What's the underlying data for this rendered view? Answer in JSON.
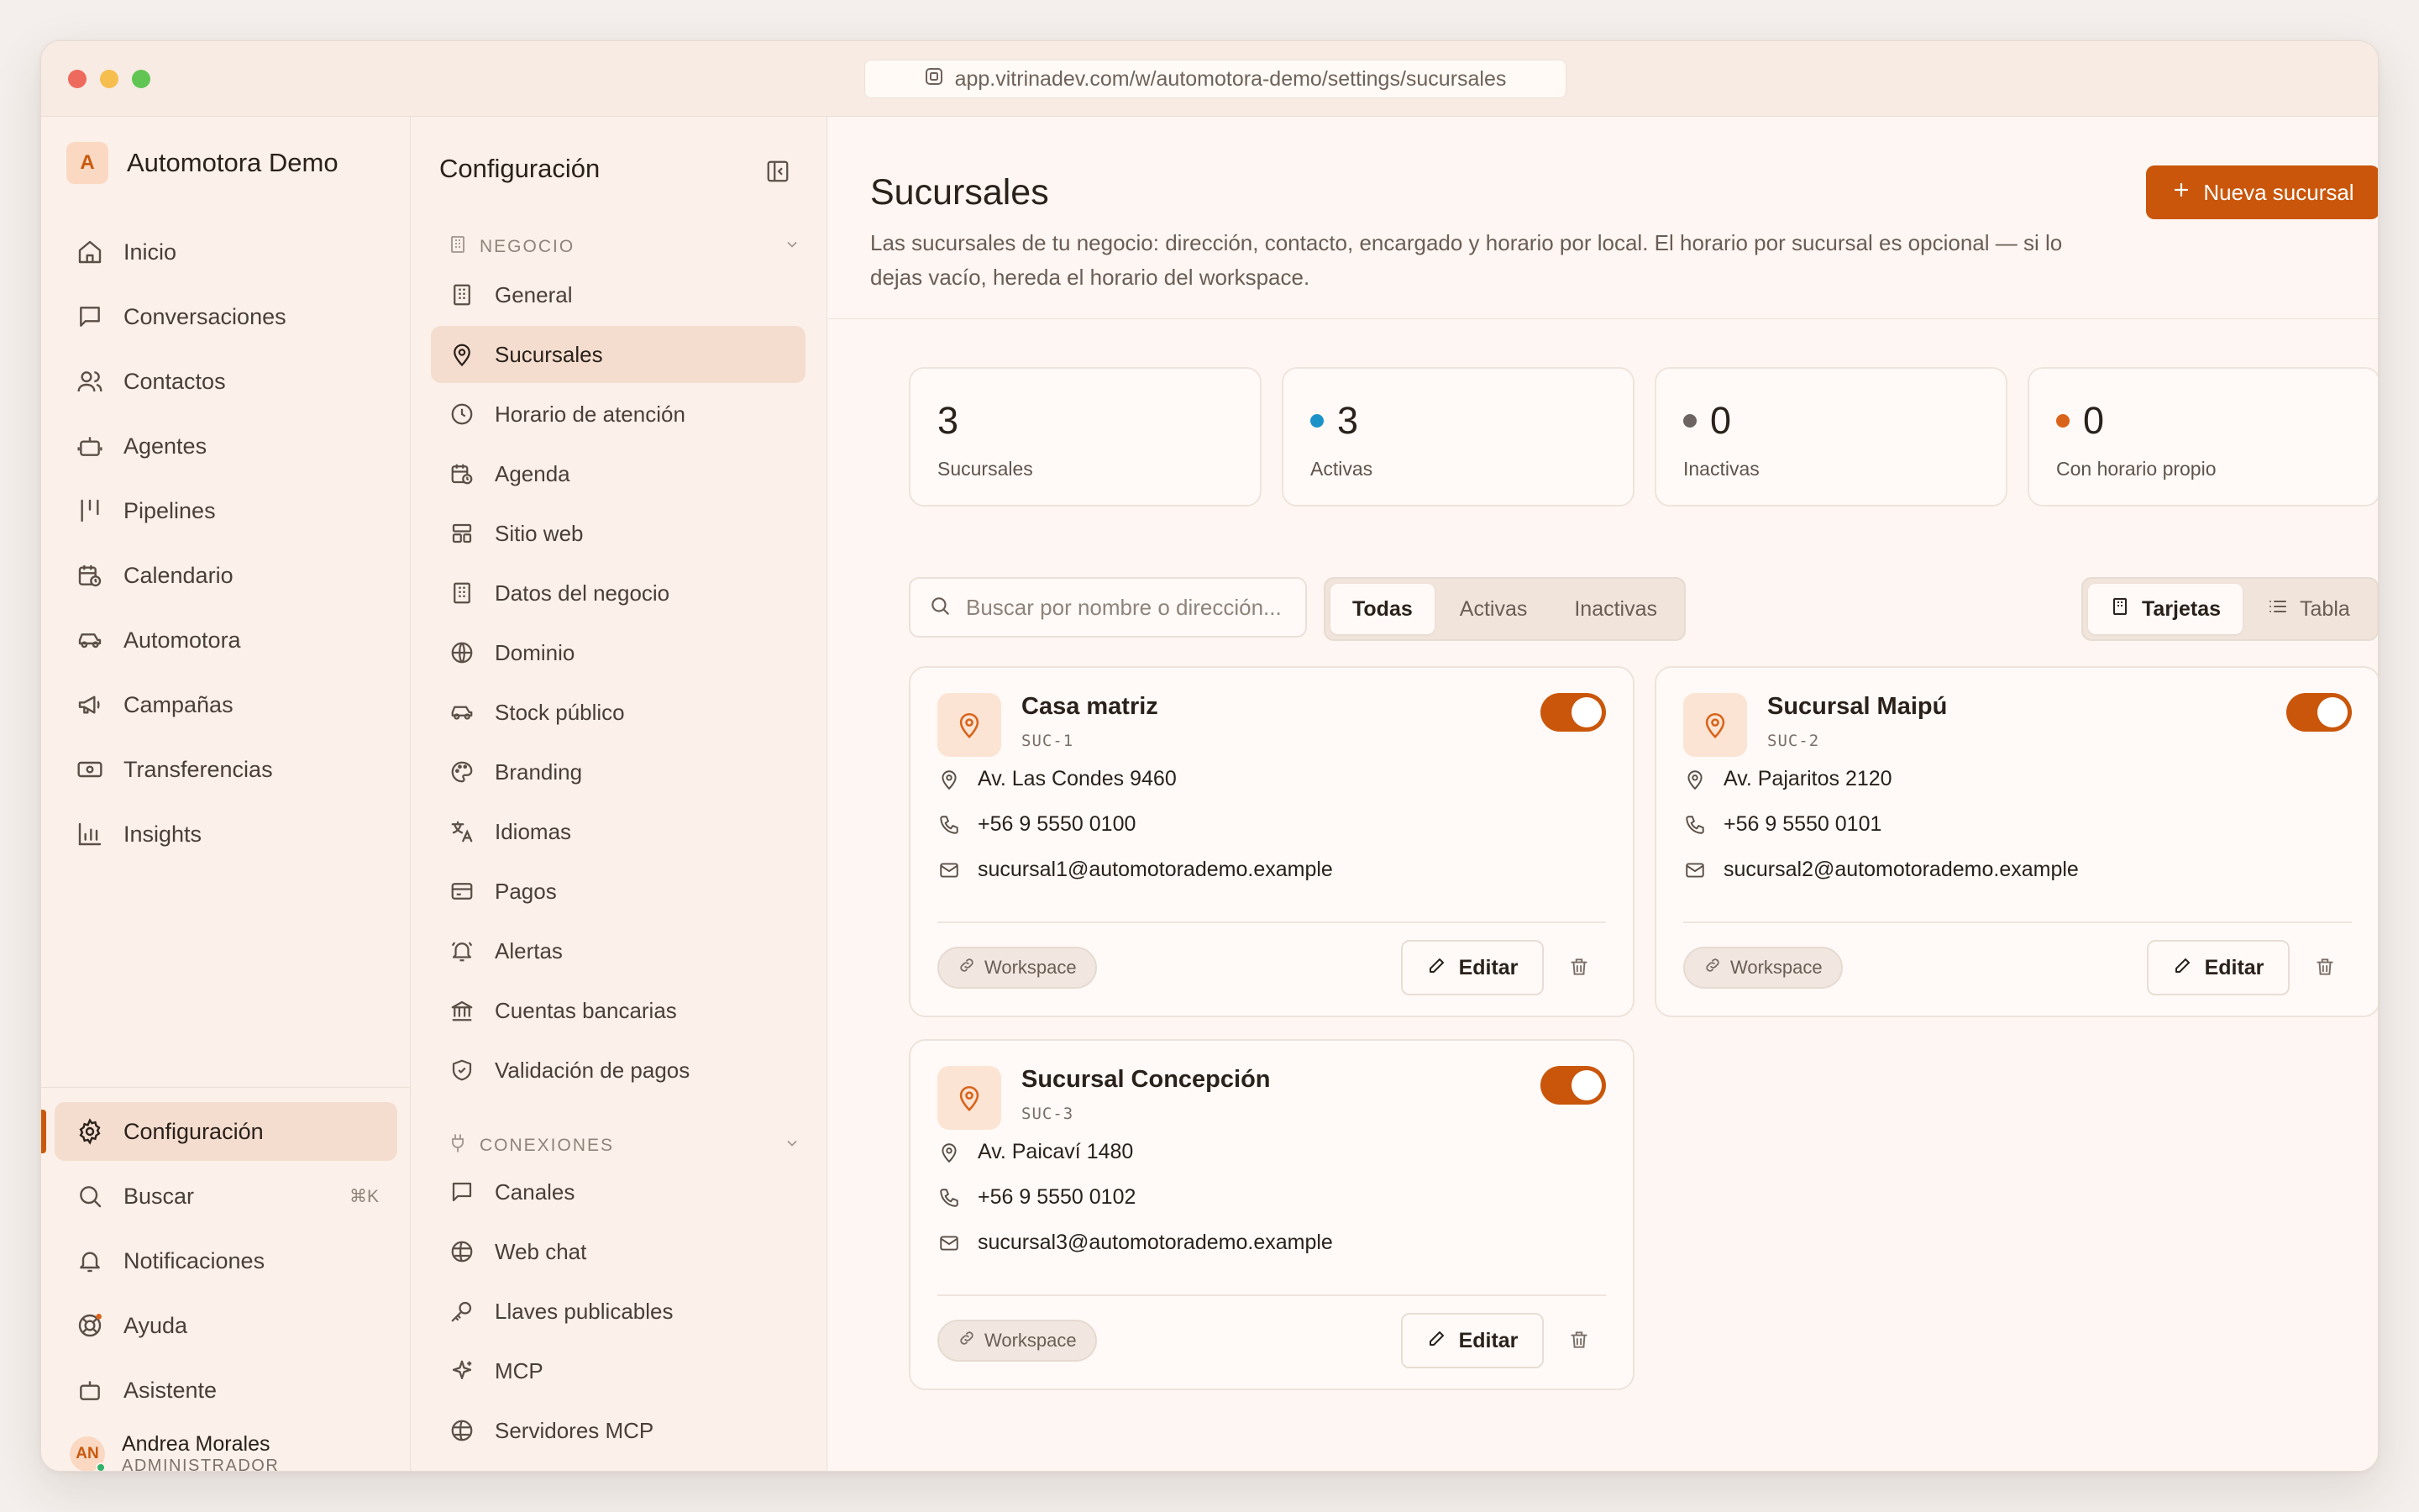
{
  "browser": {
    "url": "app.vitrinadev.com/w/automotora-demo/settings/sucursales"
  },
  "workspace": {
    "initial": "A",
    "name": "Automotora Demo"
  },
  "sidebar": {
    "items": [
      {
        "label": "Inicio",
        "icon": "home-icon"
      },
      {
        "label": "Conversaciones",
        "icon": "chat-icon"
      },
      {
        "label": "Contactos",
        "icon": "users-icon"
      },
      {
        "label": "Agentes",
        "icon": "bot-icon"
      },
      {
        "label": "Pipelines",
        "icon": "pipeline-icon"
      },
      {
        "label": "Calendario",
        "icon": "calendar-icon"
      },
      {
        "label": "Automotora",
        "icon": "car-icon"
      },
      {
        "label": "Campañas",
        "icon": "megaphone-icon"
      },
      {
        "label": "Transferencias",
        "icon": "money-icon"
      },
      {
        "label": "Insights",
        "icon": "chart-icon"
      }
    ],
    "bottom": [
      {
        "label": "Configuración",
        "icon": "gear-icon"
      },
      {
        "label": "Buscar",
        "icon": "search-icon",
        "shortcut": "⌘K"
      },
      {
        "label": "Notificaciones",
        "icon": "bell-icon"
      },
      {
        "label": "Ayuda",
        "icon": "lifebuoy-icon"
      },
      {
        "label": "Asistente",
        "icon": "assistant-icon"
      }
    ],
    "user": {
      "initials": "AN",
      "name": "Andrea Morales",
      "role": "ADMINISTRADOR"
    }
  },
  "settings": {
    "title": "Configuración",
    "negocio_label": "NEGOCIO",
    "negocio_items": [
      "General",
      "Sucursales",
      "Horario de atención",
      "Agenda",
      "Sitio web",
      "Datos del negocio",
      "Dominio",
      "Stock público",
      "Branding",
      "Idiomas",
      "Pagos",
      "Alertas",
      "Cuentas bancarias",
      "Validación de pagos"
    ],
    "conexiones_label": "CONEXIONES",
    "conexiones_items": [
      "Canales",
      "Web chat",
      "Llaves publicables",
      "MCP",
      "Servidores MCP"
    ]
  },
  "main": {
    "title": "Sucursales",
    "description": "Las sucursales de tu negocio: dirección, contacto, encargado y horario por local. El horario por sucursal es opcional — si lo dejas vacío, hereda el horario del workspace.",
    "new_button": "Nueva sucursal",
    "stats": [
      {
        "value": "3",
        "label": "Sucursales",
        "dot": ""
      },
      {
        "value": "3",
        "label": "Activas",
        "dot": "#1b93c9"
      },
      {
        "value": "0",
        "label": "Inactivas",
        "dot": "#6b6461"
      },
      {
        "value": "0",
        "label": "Con horario propio",
        "dot": "#d9631a"
      }
    ],
    "search_placeholder": "Buscar por nombre o dirección...",
    "filters": [
      "Todas",
      "Activas",
      "Inactivas"
    ],
    "active_filter": "Todas",
    "views": [
      "Tarjetas",
      "Tabla"
    ],
    "active_view": "Tarjetas",
    "edit_label": "Editar",
    "branches": [
      {
        "name": "Casa matriz",
        "code": "SUC-1",
        "address": "Av. Las Condes 9460",
        "phone": "+56 9 5550 0100",
        "email": "sucursal1@automotorademo.example",
        "schedule": "Workspace",
        "active": true
      },
      {
        "name": "Sucursal Maipú",
        "code": "SUC-2",
        "address": "Av. Pajaritos 2120",
        "phone": "+56 9 5550 0101",
        "email": "sucursal2@automotorademo.example",
        "schedule": "Workspace",
        "active": true
      },
      {
        "name": "Sucursal Concepción",
        "code": "SUC-3",
        "address": "Av. Paicaví 1480",
        "phone": "+56 9 5550 0102",
        "email": "sucursal3@automotorademo.example",
        "schedule": "Workspace",
        "active": true
      }
    ]
  },
  "colors": {
    "accent": "#c9560a",
    "accent_soft": "#fce4d4",
    "active_bg": "#f4ddcf"
  }
}
